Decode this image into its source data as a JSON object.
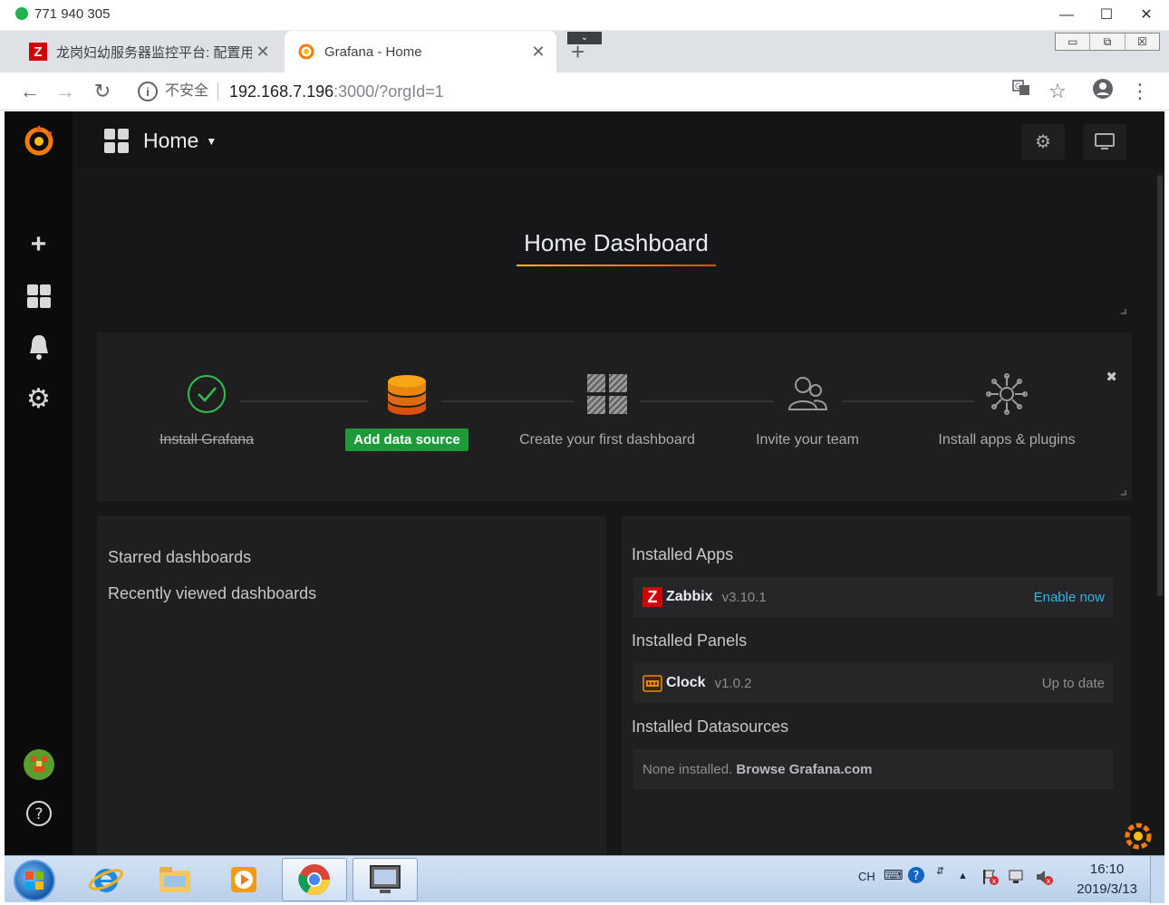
{
  "session": {
    "title": "771 940 305",
    "status_color": "#22b14c"
  },
  "browser": {
    "tabs": [
      {
        "title": "龙岗妇幼服务器监控平台: 配置用",
        "icon": "zabbix-icon",
        "active": false
      },
      {
        "title": "Grafana - Home",
        "icon": "grafana-icon",
        "active": true
      }
    ],
    "address": {
      "security": "不安全",
      "host": "192.168.7.196",
      "rest": ":3000/?orgId=1"
    }
  },
  "grafana": {
    "nav": {
      "title": "Home"
    },
    "panel_title": "Home Dashboard",
    "getting_started": {
      "steps": [
        {
          "label": "Install Grafana",
          "state": "done",
          "icon": "check-icon"
        },
        {
          "label": "Add data source",
          "state": "active",
          "icon": "database-icon"
        },
        {
          "label": "Create your first dashboard",
          "state": "todo",
          "icon": "dashboard-icon"
        },
        {
          "label": "Invite your team",
          "state": "todo",
          "icon": "team-icon"
        },
        {
          "label": "Install apps & plugins",
          "state": "todo",
          "icon": "plugins-icon"
        }
      ]
    },
    "left_panel": {
      "starred": "Starred dashboards",
      "recent": "Recently viewed dashboards"
    },
    "right_panel": {
      "apps_heading": "Installed Apps",
      "app": {
        "name": "Zabbix",
        "version": "v3.10.1",
        "action": "Enable now"
      },
      "panels_heading": "Installed Panels",
      "panel": {
        "name": "Clock",
        "version": "v1.0.2",
        "status": "Up to date"
      },
      "datasources_heading": "Installed Datasources",
      "datasources_none": "None installed.",
      "datasources_link": "Browse Grafana.com"
    },
    "colors": {
      "background": "#161719",
      "panel": "#1f1f20",
      "accent_orange": "#f57c00",
      "success_green": "#1d9b3b",
      "link_blue": "#33b5e5"
    }
  },
  "taskbar": {
    "apps": [
      "internet-explorer-icon",
      "file-explorer-icon",
      "media-player-icon",
      "chrome-icon",
      "remote-desktop-icon"
    ],
    "ime": "CH",
    "time": "16:10",
    "date": "2019/3/13"
  }
}
